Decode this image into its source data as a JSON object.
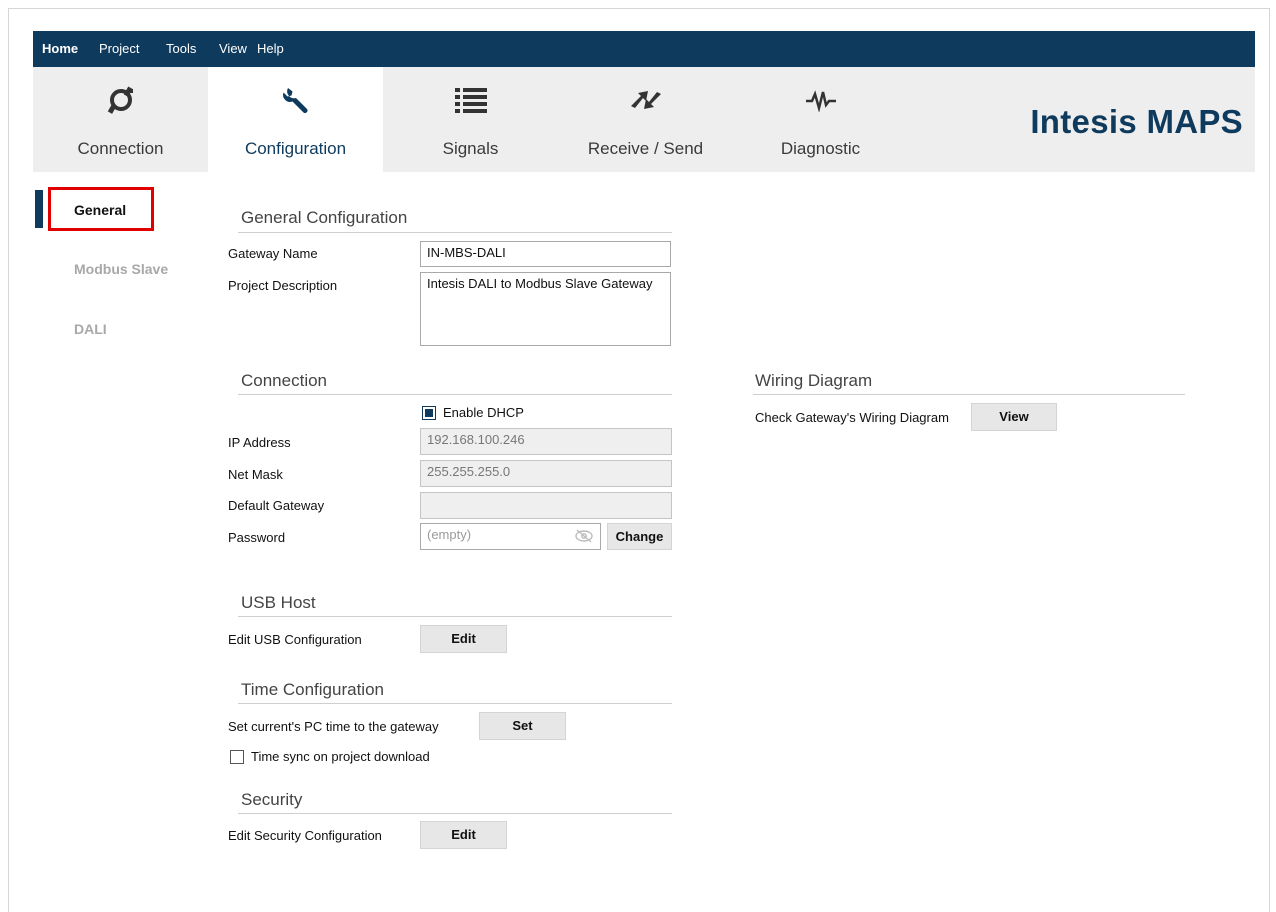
{
  "menu": {
    "items": [
      {
        "label": "Home",
        "active": true
      },
      {
        "label": "Project"
      },
      {
        "label": "Tools"
      },
      {
        "label": "View"
      },
      {
        "label": "Help"
      }
    ]
  },
  "toolbar": {
    "tabs": [
      {
        "label": "Connection",
        "icon": "plug-icon"
      },
      {
        "label": "Configuration",
        "icon": "wrench-icon",
        "active": true
      },
      {
        "label": "Signals",
        "icon": "list-icon"
      },
      {
        "label": "Receive / Send",
        "icon": "transfer-icon"
      },
      {
        "label": "Diagnostic",
        "icon": "pulse-icon"
      }
    ],
    "brand": "Intesis MAPS"
  },
  "sidebar": {
    "items": [
      {
        "label": "General",
        "active": true
      },
      {
        "label": "Modbus Slave"
      },
      {
        "label": "DALI"
      }
    ]
  },
  "general": {
    "title": "General Configuration",
    "gateway_name_label": "Gateway Name",
    "gateway_name_value": "IN-MBS-DALI",
    "project_description_label": "Project Description",
    "project_description_value": "Intesis DALI to Modbus Slave Gateway"
  },
  "connection": {
    "title": "Connection",
    "dhcp_label": "Enable DHCP",
    "dhcp_checked": true,
    "ip_label": "IP Address",
    "ip_value": "192.168.100.246",
    "netmask_label": "Net Mask",
    "netmask_value": "255.255.255.0",
    "gateway_label": "Default Gateway",
    "gateway_value": "",
    "password_label": "Password",
    "password_placeholder": "(empty)",
    "change_label": "Change"
  },
  "wiring": {
    "title": "Wiring Diagram",
    "label": "Check Gateway's Wiring Diagram",
    "button": "View"
  },
  "usb": {
    "title": "USB Host",
    "label": "Edit USB Configuration",
    "button": "Edit"
  },
  "time": {
    "title": "Time Configuration",
    "label": "Set current's PC time to the gateway",
    "button": "Set",
    "sync_label": "Time sync on project download",
    "sync_checked": false
  },
  "security": {
    "title": "Security",
    "label": "Edit Security Configuration",
    "button": "Edit"
  },
  "colors": {
    "accent": "#0e3a5d",
    "highlight": "#e00000"
  }
}
